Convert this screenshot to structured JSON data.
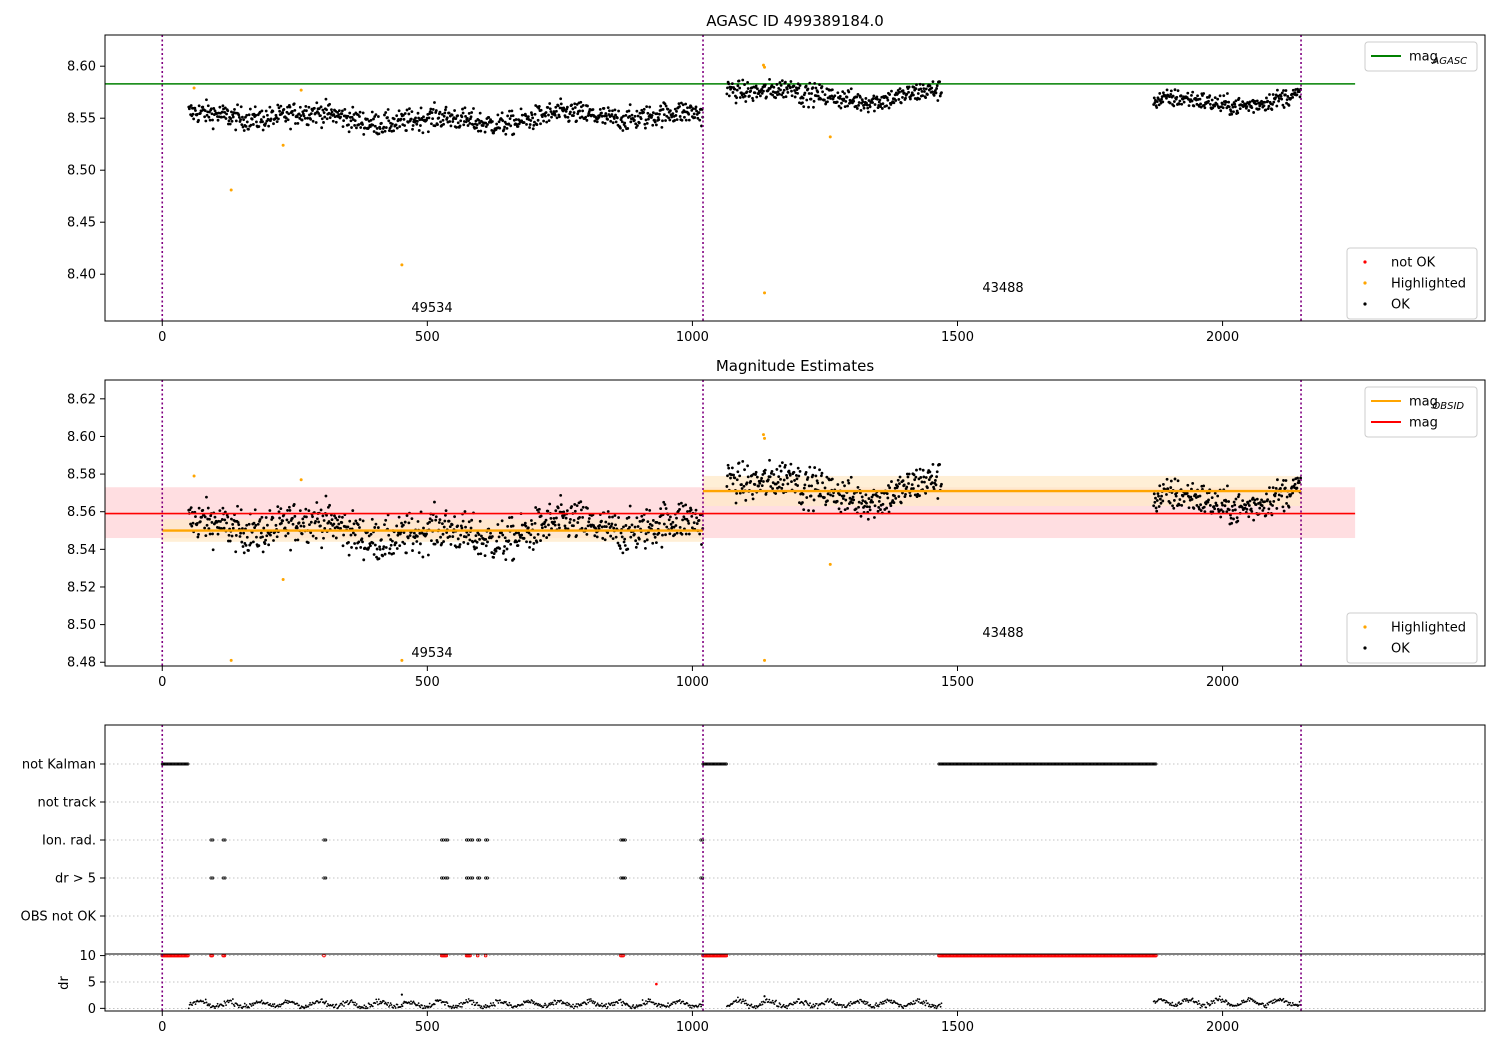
{
  "figure": {
    "panels": [
      {
        "id": "agasc",
        "title": "AGASC ID 499389184.0",
        "ylim": [
          8.355,
          8.63
        ],
        "yticks": [
          "8.40",
          "8.45",
          "8.50",
          "8.55",
          "8.60"
        ],
        "ytick_values": [
          8.4,
          8.45,
          8.5,
          8.55,
          8.6
        ],
        "legend_top": [
          {
            "label": "mag",
            "subscript": "AGASC",
            "color": "#008000",
            "kind": "line"
          }
        ],
        "legend_bottom": [
          {
            "label": "not OK",
            "color": "#ff0000",
            "kind": "dot"
          },
          {
            "label": "Highlighted",
            "color": "#ffa500",
            "kind": "dot"
          },
          {
            "label": "OK",
            "color": "#000000",
            "kind": "dot"
          }
        ]
      },
      {
        "id": "estimates",
        "title": "Magnitude Estimates",
        "ylim": [
          8.478,
          8.63
        ],
        "yticks": [
          "8.48",
          "8.50",
          "8.52",
          "8.54",
          "8.56",
          "8.58",
          "8.60",
          "8.62"
        ],
        "ytick_values": [
          8.48,
          8.5,
          8.52,
          8.54,
          8.56,
          8.58,
          8.6,
          8.62
        ],
        "legend_top": [
          {
            "label": "mag",
            "subscript": "OBSID",
            "color": "#ffa500",
            "kind": "line"
          },
          {
            "label": "mag",
            "subscript": "",
            "color": "#ff0000",
            "kind": "line"
          }
        ],
        "legend_bottom": [
          {
            "label": "Highlighted",
            "color": "#ffa500",
            "kind": "dot"
          },
          {
            "label": "OK",
            "color": "#000000",
            "kind": "dot"
          }
        ]
      },
      {
        "id": "flags",
        "flag_labels": [
          "not Kalman",
          "not track",
          "Ion. rad.",
          "dr > 5",
          "OBS not OK"
        ]
      },
      {
        "id": "dr",
        "ylabel": "dr",
        "yticks": [
          "0",
          "5",
          "10"
        ],
        "ytick_values": [
          0,
          5,
          10
        ],
        "ylim": [
          -0.5,
          10.3
        ]
      }
    ],
    "xlim": [
      -108,
      2495
    ],
    "xticks": [
      "0",
      "500",
      "1000",
      "1500",
      "2000"
    ],
    "xtick_values": [
      0,
      500,
      1000,
      1500,
      2000
    ],
    "colors": {
      "ok": "#000000",
      "highlighted": "#ffa500",
      "not_ok": "#ff0000",
      "agasc_line": "#008000",
      "obs_boundary": "#800080",
      "mean_line": "#ff0000",
      "mean_band": "#ffd8dc",
      "obsid_band": "#ffe9c8"
    }
  },
  "chart_data": {
    "type": "scatter",
    "title": "AGASC ID 499389184.0",
    "subtitle": "Magnitude Estimates",
    "x_range": [
      -108,
      2495
    ],
    "obs_boundaries": [
      0,
      1020,
      2148
    ],
    "observations": [
      {
        "obsid": "49534",
        "x_start": 0,
        "x_end": 1020,
        "mag_obsid": 8.55,
        "band": [
          8.544,
          8.556
        ]
      },
      {
        "obsid": "43488",
        "x_start": 1020,
        "x_end": 2148,
        "mag_obsid": 8.571,
        "band": [
          8.563,
          8.579
        ]
      }
    ],
    "mag_agasc": 8.583,
    "mag_agasc_x_range": [
      0,
      2250
    ],
    "mag": 8.559,
    "mag_band": [
      8.546,
      8.573
    ],
    "mag_x_range": [
      0,
      2250
    ],
    "ok_segments": [
      {
        "x": [
          50,
          1020
        ],
        "y_mean": 8.55,
        "y_spread": 0.01
      },
      {
        "x": [
          1065,
          1470
        ],
        "y_mean": 8.572,
        "y_spread": 0.009
      },
      {
        "x": [
          1870,
          2148
        ],
        "y_mean": 8.568,
        "y_spread": 0.008
      }
    ],
    "highlighted_points": [
      {
        "x": 60,
        "y": 8.579
      },
      {
        "x": 130,
        "y": 8.481
      },
      {
        "x": 228,
        "y": 8.524
      },
      {
        "x": 262,
        "y": 8.577
      },
      {
        "x": 452,
        "y": 8.409
      },
      {
        "x": 1134,
        "y": 8.601
      },
      {
        "x": 1136,
        "y": 8.599
      },
      {
        "x": 1136,
        "y": 8.382
      },
      {
        "x": 1260,
        "y": 8.532
      }
    ],
    "flags": {
      "not Kalman": [
        [
          0,
          50
        ],
        [
          1020,
          1065
        ],
        [
          1465,
          1875
        ]
      ],
      "not track": [],
      "Ion. rad.": [
        92,
        115,
        305,
        527,
        535,
        574,
        582,
        595,
        610,
        865,
        870,
        1016
      ],
      "dr > 5": [
        92,
        115,
        305,
        527,
        535,
        574,
        582,
        595,
        610,
        865,
        870,
        1016
      ],
      "OBS not OK": []
    },
    "dr_flagged_at_10": [
      [
        0,
        50
      ],
      [
        92,
        95
      ],
      [
        115,
        118
      ],
      [
        305,
        306
      ],
      [
        527,
        537
      ],
      [
        574,
        582
      ],
      [
        595,
        596
      ],
      [
        610,
        611
      ],
      [
        865,
        870
      ],
      [
        1020,
        1065
      ],
      [
        1465,
        1875
      ]
    ],
    "dr_extra_points": [
      {
        "x": 932,
        "y": 4.6
      }
    ],
    "dr_ok_segments": [
      {
        "x": [
          50,
          1020
        ],
        "y_mean": 0.8
      },
      {
        "x": [
          1065,
          1470
        ],
        "y_mean": 0.9
      },
      {
        "x": [
          1870,
          2148
        ],
        "y_mean": 1.1
      }
    ],
    "obsid_labels": [
      "49534",
      "43488"
    ],
    "grid": "flags panel horizontal dotted",
    "legend_placement": "top-right and bottom-right"
  }
}
